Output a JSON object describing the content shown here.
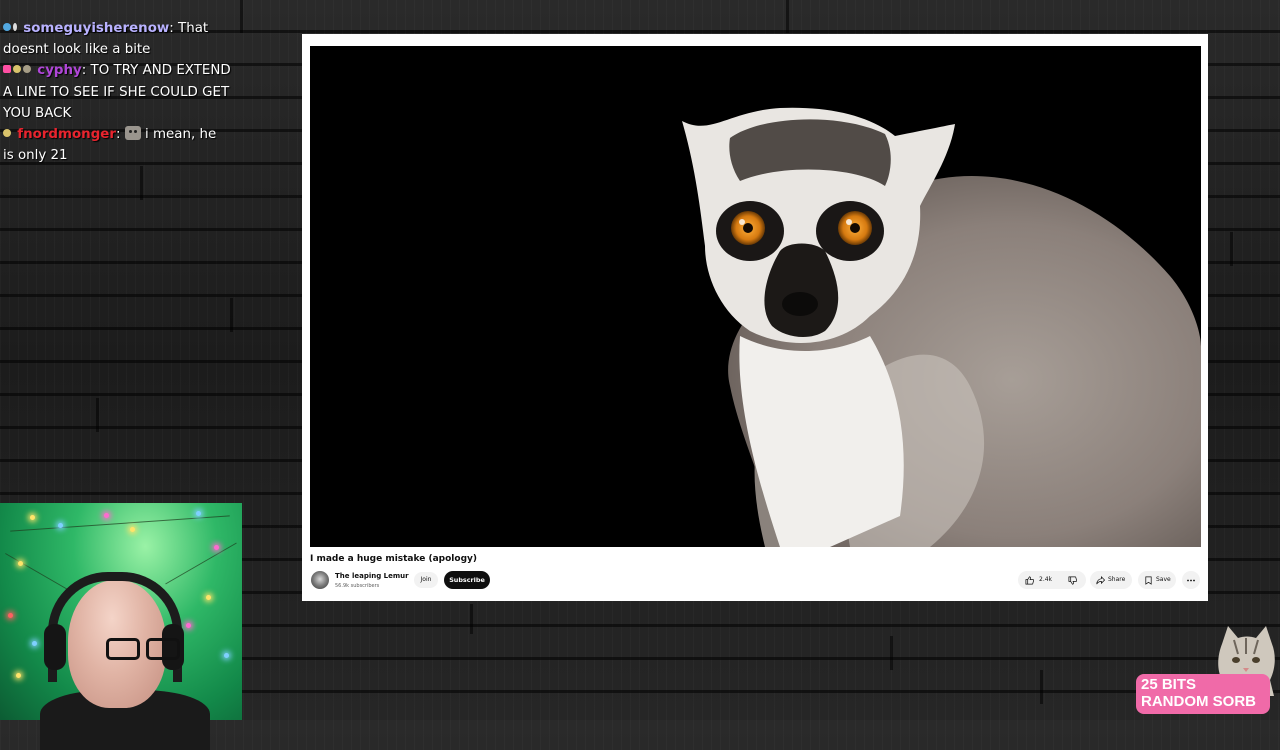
{
  "chat": {
    "messages": [
      {
        "user": "someguyisherenow",
        "text": ": That doesnt look like a bite",
        "user_color": "#b9b2ff",
        "badge_colors": [
          "#52a8e0",
          "#dddddd"
        ],
        "emote": false
      },
      {
        "user": "cyphy",
        "text": ": TO TRY AND EXTEND A LINE TO SEE IF SHE COULD GET YOU BACK",
        "user_color": "#b046d8",
        "badge_colors": [
          "#ff4fa3",
          "#d9c36b",
          "#a69d86"
        ],
        "emote": false
      },
      {
        "user": "fnordmonger",
        "text": " i mean, he is only 21",
        "user_color": "#e8242e",
        "badge_colors": [
          "#d9c36b"
        ],
        "emote": true,
        "emote_name": "cat-emote"
      }
    ]
  },
  "video": {
    "title": "I made a huge mistake (apology)",
    "channel_name": "The leaping Lemur",
    "subscribers": "56.9k subscribers",
    "join_label": "Join",
    "subscribe_label": "Subscribe",
    "like_count": "2.4k",
    "share_label": "Share",
    "save_label": "Save",
    "thumbnail_subject": "ring-tailed lemur"
  },
  "alert": {
    "line1": "25 BITS",
    "line2": "RANDOM SORB",
    "color": "#f06aa8"
  }
}
